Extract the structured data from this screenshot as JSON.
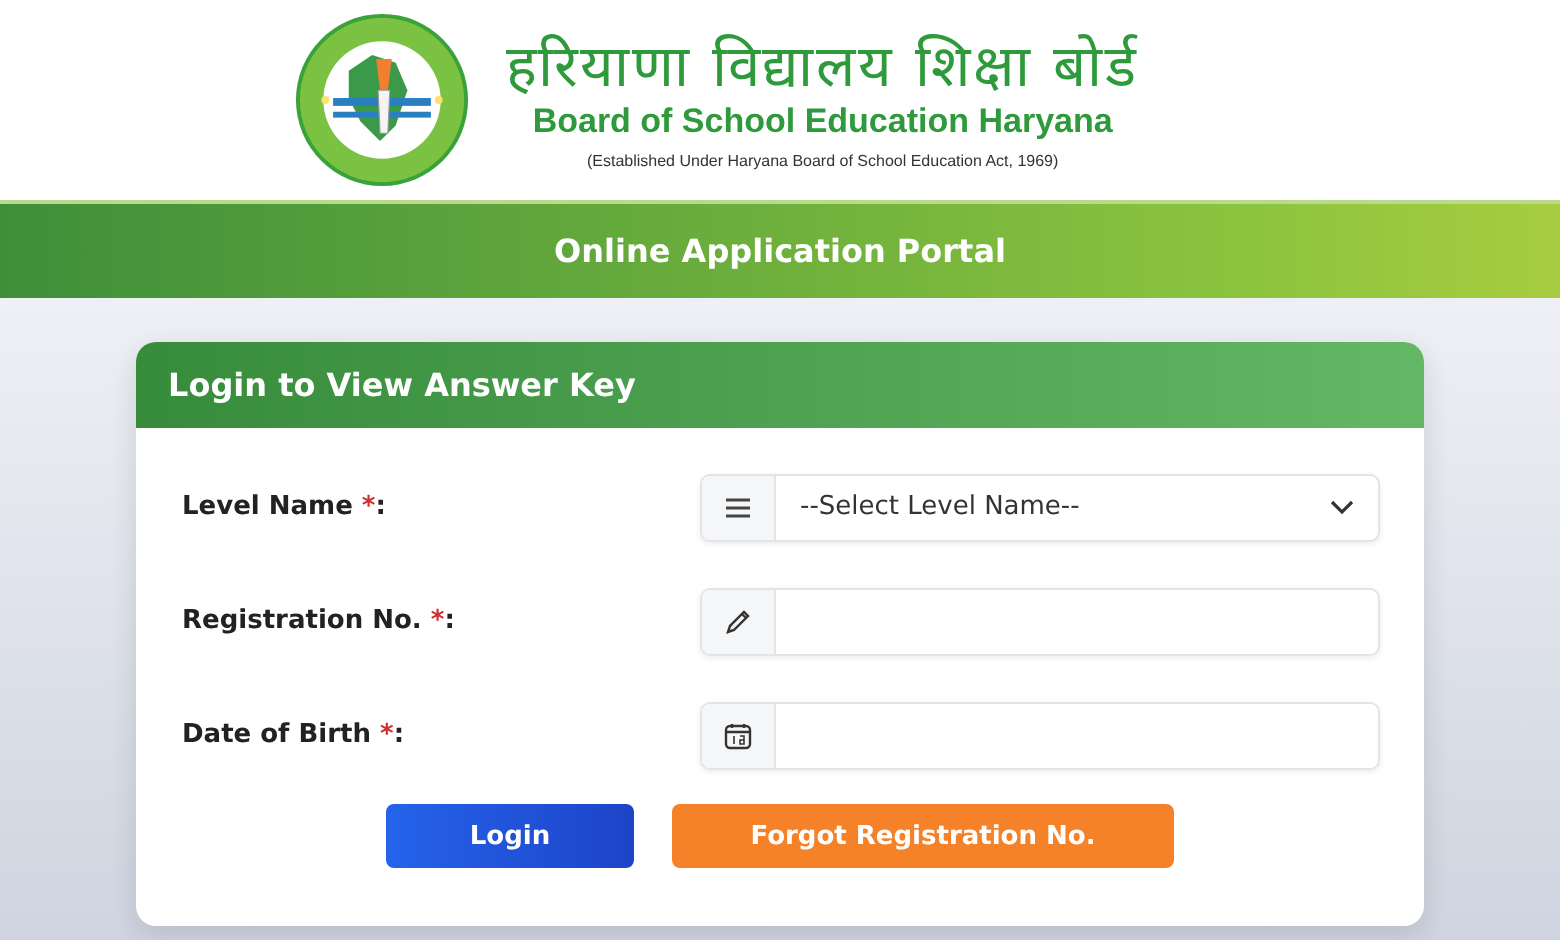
{
  "header": {
    "title_hindi": "हरियाणा विद्यालय शिक्षा बोर्ड",
    "title_english": "Board of School Education Haryana",
    "subtitle": "(Established Under Haryana Board of School Education Act, 1969)"
  },
  "banner": {
    "title": "Online Application Portal"
  },
  "card": {
    "title": "Login to View Answer Key",
    "fields": [
      {
        "kind": "select",
        "label": "Level Name",
        "required_mark": "*",
        "suffix": ":",
        "placeholder": "--Select Level Name--"
      },
      {
        "kind": "text",
        "label": "Registration No.",
        "required_mark": "*",
        "suffix": ":"
      },
      {
        "kind": "date",
        "label": "Date of Birth",
        "required_mark": "*",
        "suffix": ":"
      }
    ],
    "buttons": [
      {
        "kind": "primary",
        "label": "Login"
      },
      {
        "kind": "warning",
        "label": "Forgot Registration No."
      }
    ]
  }
}
